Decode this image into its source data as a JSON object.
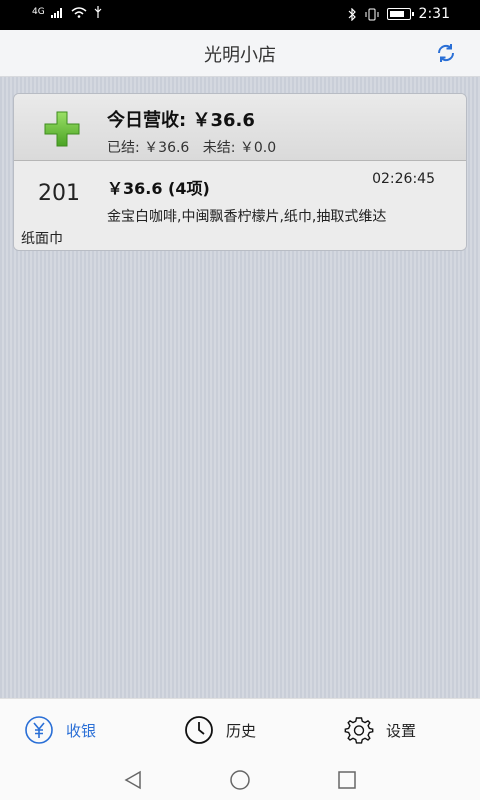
{
  "status_bar": {
    "network": "4G",
    "time": "2:31"
  },
  "app_bar": {
    "title": "光明小店"
  },
  "summary": {
    "headline": "今日营收: ￥36.6",
    "detail": "已结: ￥36.6   未结: ￥0.0"
  },
  "order": {
    "number": "201",
    "amount": "￥36.6 (4项)",
    "time": "02:26:45",
    "items_line1": "金宝白咖啡,中闽飘香柠檬片,纸巾,抽取式维达",
    "items_line2": "纸面巾"
  },
  "tabs": [
    {
      "label": "收银",
      "icon": "yen-circle-icon",
      "active": true
    },
    {
      "label": "历史",
      "icon": "clock-icon",
      "active": false
    },
    {
      "label": "设置",
      "icon": "gear-icon",
      "active": false
    }
  ],
  "colors": {
    "accent": "#2a6fd6",
    "plus_green": "#6cc13a"
  }
}
